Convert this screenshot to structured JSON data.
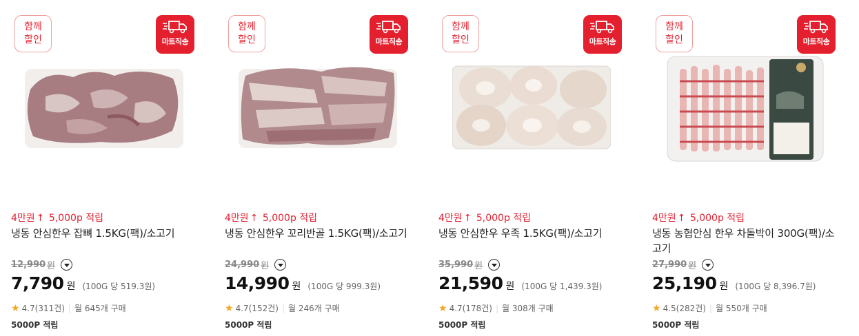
{
  "colors": {
    "accent": "#e4202f",
    "star": "#f5a623"
  },
  "products": [
    {
      "badge_group": [
        "함께",
        "할인"
      ],
      "badge_mart": "마트직송",
      "image_icon": "frozen-beef-bones-photo",
      "promo_tier": "4만원",
      "promo_arrow": "↑",
      "promo_points": "5,000p 적립",
      "name": "냉동 안심한우 잡뼈 1.5KG(팩)/소고기",
      "original_price": "12,990",
      "original_unit": "원",
      "price": "7,790",
      "price_unit": "원",
      "unit_price": "(100G 당 519.3원)",
      "rating": "4.7",
      "reviews": "(311건)",
      "monthly_sales": "월 645개 구매",
      "points": "5000P 적립"
    },
    {
      "badge_group": [
        "함께",
        "할인"
      ],
      "badge_mart": "마트직송",
      "image_icon": "frozen-beef-tail-photo",
      "promo_tier": "4만원",
      "promo_arrow": "↑",
      "promo_points": "5,000p 적립",
      "name": "냉동 안심한우 꼬리반골 1.5KG(팩)/소고기",
      "original_price": "24,990",
      "original_unit": "원",
      "price": "14,990",
      "price_unit": "원",
      "unit_price": "(100G 당 999.3원)",
      "rating": "4.7",
      "reviews": "(152건)",
      "monthly_sales": "월 246개 구매",
      "points": "5000P 적립"
    },
    {
      "badge_group": [
        "함께",
        "할인"
      ],
      "badge_mart": "마트직송",
      "image_icon": "frozen-beef-shank-photo",
      "promo_tier": "4만원",
      "promo_arrow": "↑",
      "promo_points": "5,000p 적립",
      "name": "냉동 안심한우 우족 1.5KG(팩)/소고기",
      "original_price": "35,990",
      "original_unit": "원",
      "price": "21,590",
      "price_unit": "원",
      "unit_price": "(100G 당 1,439.3원)",
      "rating": "4.7",
      "reviews": "(178건)",
      "monthly_sales": "월 308개 구매",
      "points": "5000P 적립"
    },
    {
      "badge_group": [
        "함께",
        "할인"
      ],
      "badge_mart": "마트직송",
      "image_icon": "beef-brisket-tray-photo",
      "promo_tier": "4만원",
      "promo_arrow": "↑",
      "promo_points": "5,000p 적립",
      "name": "냉동 농협안심 한우 차돌박이 300G(팩)/소고기",
      "original_price": "27,990",
      "original_unit": "원",
      "price": "25,190",
      "price_unit": "원",
      "unit_price": "(100G 당 8,396.7원)",
      "rating": "4.5",
      "reviews": "(282건)",
      "monthly_sales": "월 550개 구매",
      "points": "5000P 적립"
    }
  ]
}
